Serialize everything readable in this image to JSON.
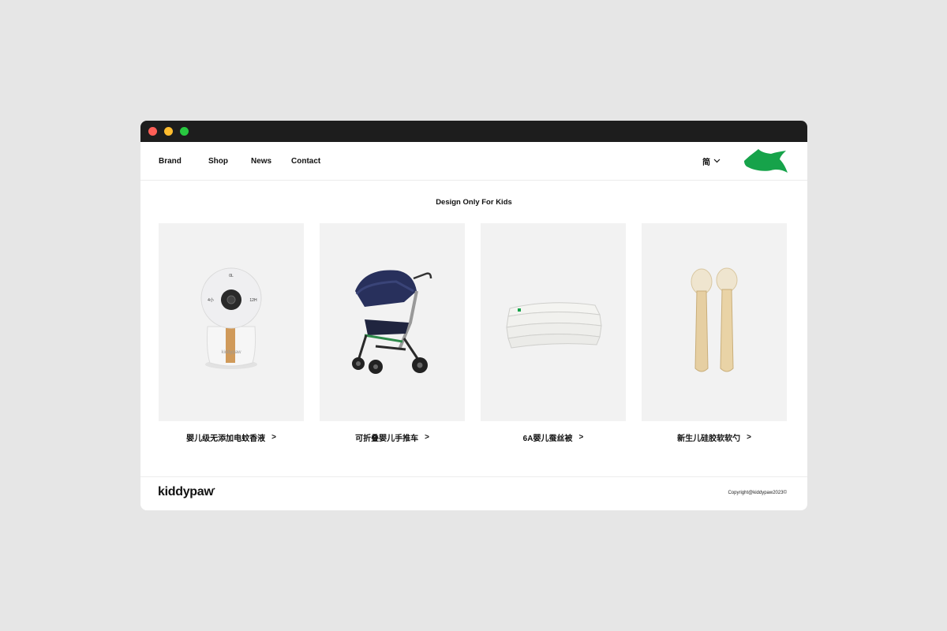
{
  "nav": {
    "brand": "Brand",
    "shop": "Shop",
    "news": "News",
    "contact": "Contact"
  },
  "language": {
    "label": "简"
  },
  "tagline": "Design Only For Kids",
  "products": [
    {
      "name": "婴儿级无添加电蚊香液"
    },
    {
      "name": "可折叠婴儿手推车"
    },
    {
      "name": "6A婴儿蚕丝被"
    },
    {
      "name": "新生儿硅胶软软勺"
    }
  ],
  "diffuser_text": {
    "top": "0L",
    "left": "4小",
    "right": "12H",
    "brand": "kiddypaw"
  },
  "footer": {
    "wordmark": "kiddypaw",
    "copyright": "Copyright@kiddypaw2023©"
  },
  "colors": {
    "accent_green": "#16a34a",
    "titlebar": "#1d1d1d"
  }
}
